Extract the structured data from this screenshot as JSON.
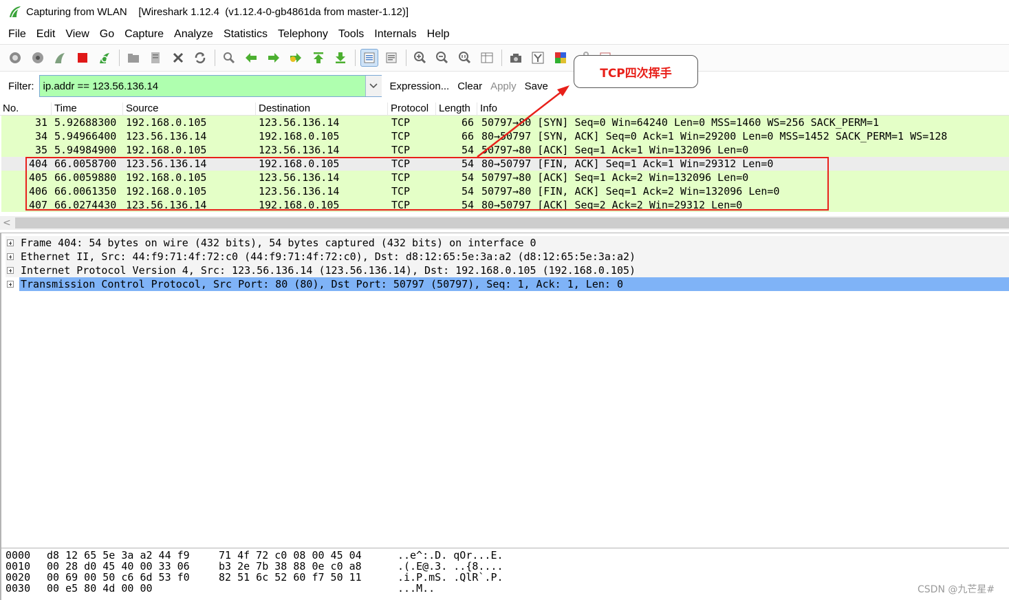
{
  "window": {
    "title": "Capturing from WLAN    [Wireshark 1.12.4  (v1.12.4-0-gb4861da from master-1.12)]"
  },
  "menu": [
    {
      "label": "File"
    },
    {
      "label": "Edit"
    },
    {
      "label": "View"
    },
    {
      "label": "Go"
    },
    {
      "label": "Capture"
    },
    {
      "label": "Analyze"
    },
    {
      "label": "Statistics"
    },
    {
      "label": "Telephony"
    },
    {
      "label": "Tools"
    },
    {
      "label": "Internals"
    },
    {
      "label": "Help"
    }
  ],
  "toolbar_icons": [
    "interfaces-icon",
    "options-icon",
    "start-capture-icon",
    "stop-capture-icon",
    "restart-capture-icon",
    "open-file-icon",
    "save-file-icon",
    "close-file-icon",
    "reload-icon",
    "find-packet-icon",
    "go-back-icon",
    "go-forward-icon",
    "go-to-packet-icon",
    "go-first-icon",
    "go-last-icon",
    "colorize-icon",
    "autoscroll-icon",
    "zoom-in-icon",
    "zoom-out-icon",
    "zoom-normal-icon",
    "resize-columns-icon",
    "capture-filters-icon",
    "display-filters-icon",
    "coloring-rules-icon",
    "preferences-icon",
    "help-icon"
  ],
  "filter": {
    "label": "Filter:",
    "value": "ip.addr == 123.56.136.14",
    "buttons": {
      "expression": "Expression...",
      "clear": "Clear",
      "apply": "Apply",
      "save": "Save"
    }
  },
  "annotation": {
    "callout_text": "TCP四次挥手",
    "color": "#e8201a"
  },
  "packet_list": {
    "columns": [
      "No.",
      "Time",
      "Source",
      "Destination",
      "Protocol",
      "Length",
      "Info"
    ],
    "rows": [
      {
        "no": "31",
        "time": "5.92688300",
        "source": "192.168.0.105",
        "destination": "123.56.136.14",
        "protocol": "TCP",
        "length": "66",
        "info": "50797→80 [SYN] Seq=0 Win=64240 Len=0 MSS=1460 WS=256 SACK_PERM=1"
      },
      {
        "no": "34",
        "time": "5.94966400",
        "source": "123.56.136.14",
        "destination": "192.168.0.105",
        "protocol": "TCP",
        "length": "66",
        "info": "80→50797 [SYN, ACK] Seq=0 Ack=1 Win=29200 Len=0 MSS=1452 SACK_PERM=1 WS=128"
      },
      {
        "no": "35",
        "time": "5.94984900",
        "source": "192.168.0.105",
        "destination": "123.56.136.14",
        "protocol": "TCP",
        "length": "54",
        "info": "50797→80 [ACK] Seq=1 Ack=1 Win=132096 Len=0"
      },
      {
        "no": "404",
        "time": "66.0058700",
        "source": "123.56.136.14",
        "destination": "192.168.0.105",
        "protocol": "TCP",
        "length": "54",
        "info": "80→50797 [FIN, ACK] Seq=1 Ack=1 Win=29312 Len=0"
      },
      {
        "no": "405",
        "time": "66.0059880",
        "source": "192.168.0.105",
        "destination": "123.56.136.14",
        "protocol": "TCP",
        "length": "54",
        "info": "50797→80 [ACK] Seq=1 Ack=2 Win=132096 Len=0"
      },
      {
        "no": "406",
        "time": "66.0061350",
        "source": "192.168.0.105",
        "destination": "123.56.136.14",
        "protocol": "TCP",
        "length": "54",
        "info": "50797→80 [FIN, ACK] Seq=1 Ack=2 Win=132096 Len=0"
      },
      {
        "no": "407",
        "time": "66.0274430",
        "source": "123.56.136.14",
        "destination": "192.168.0.105",
        "protocol": "TCP",
        "length": "54",
        "info": "80→50797 [ACK] Seq=2 Ack=2 Win=29312 Len=0"
      }
    ]
  },
  "details": [
    {
      "text": "Frame 404: 54 bytes on wire (432 bits), 54 bytes captured (432 bits) on interface 0"
    },
    {
      "text": "Ethernet II, Src: 44:f9:71:4f:72:c0 (44:f9:71:4f:72:c0), Dst: d8:12:65:5e:3a:a2 (d8:12:65:5e:3a:a2)"
    },
    {
      "text": "Internet Protocol Version 4, Src: 123.56.136.14 (123.56.136.14), Dst: 192.168.0.105 (192.168.0.105)"
    },
    {
      "text": "Transmission Control Protocol, Src Port: 80 (80), Dst Port: 50797 (50797), Seq: 1, Ack: 1, Len: 0"
    }
  ],
  "bytes": [
    {
      "offset": "0000",
      "hex1": "d8 12 65 5e 3a a2 44 f9",
      "hex2": "71 4f 72 c0 08 00 45 04",
      "ascii": "..e^:.D. qOr...E."
    },
    {
      "offset": "0010",
      "hex1": "00 28 d0 45 40 00 33 06",
      "hex2": "b3 2e 7b 38 88 0e c0 a8",
      "ascii": ".(.E@.3. ..{8...."
    },
    {
      "offset": "0020",
      "hex1": "00 69 00 50 c6 6d 53 f0",
      "hex2": "82 51 6c 52 60 f7 50 11",
      "ascii": ".i.P.mS. .QlR`.P."
    },
    {
      "offset": "0030",
      "hex1": "00 e5 80 4d 00 00",
      "hex2": "",
      "ascii": "...M.."
    }
  ],
  "watermark": "CSDN @九芒星#",
  "colors": {
    "row_green": "#e4ffc7",
    "row_selected": "#ececec",
    "filter_valid": "#afffaf",
    "detail_selected": "#7fb3f7"
  }
}
